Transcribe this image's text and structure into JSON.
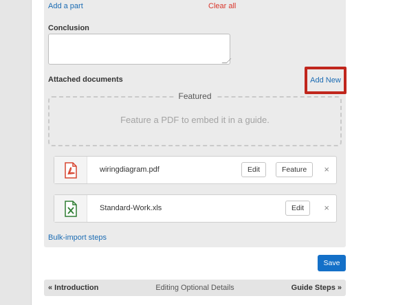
{
  "parts": {
    "add_part": "Add a part",
    "clear_all": "Clear all"
  },
  "conclusion": {
    "label": "Conclusion",
    "value": ""
  },
  "attachments": {
    "label": "Attached documents",
    "add_new": "Add New",
    "featured_title": "Featured",
    "featured_hint": "Feature a PDF to embed it in a guide.",
    "documents": [
      {
        "name": "wiringdiagram.pdf",
        "icon": "pdf-file-icon",
        "edit": "Edit",
        "feature": "Feature",
        "remove": "×"
      },
      {
        "name": "Standard-Work.xls",
        "icon": "excel-file-icon",
        "edit": "Edit",
        "remove": "×"
      }
    ]
  },
  "bulk_import": "Bulk-import steps",
  "save": "Save",
  "nav": {
    "prev": "« Introduction",
    "current": "Editing Optional Details",
    "next": "Guide Steps »"
  },
  "colors": {
    "link": "#1a6bb3",
    "danger": "#d9362b",
    "highlight": "#c0261c",
    "primary": "#1470c8",
    "pdf": "#d6442f",
    "excel": "#2e7d32"
  }
}
